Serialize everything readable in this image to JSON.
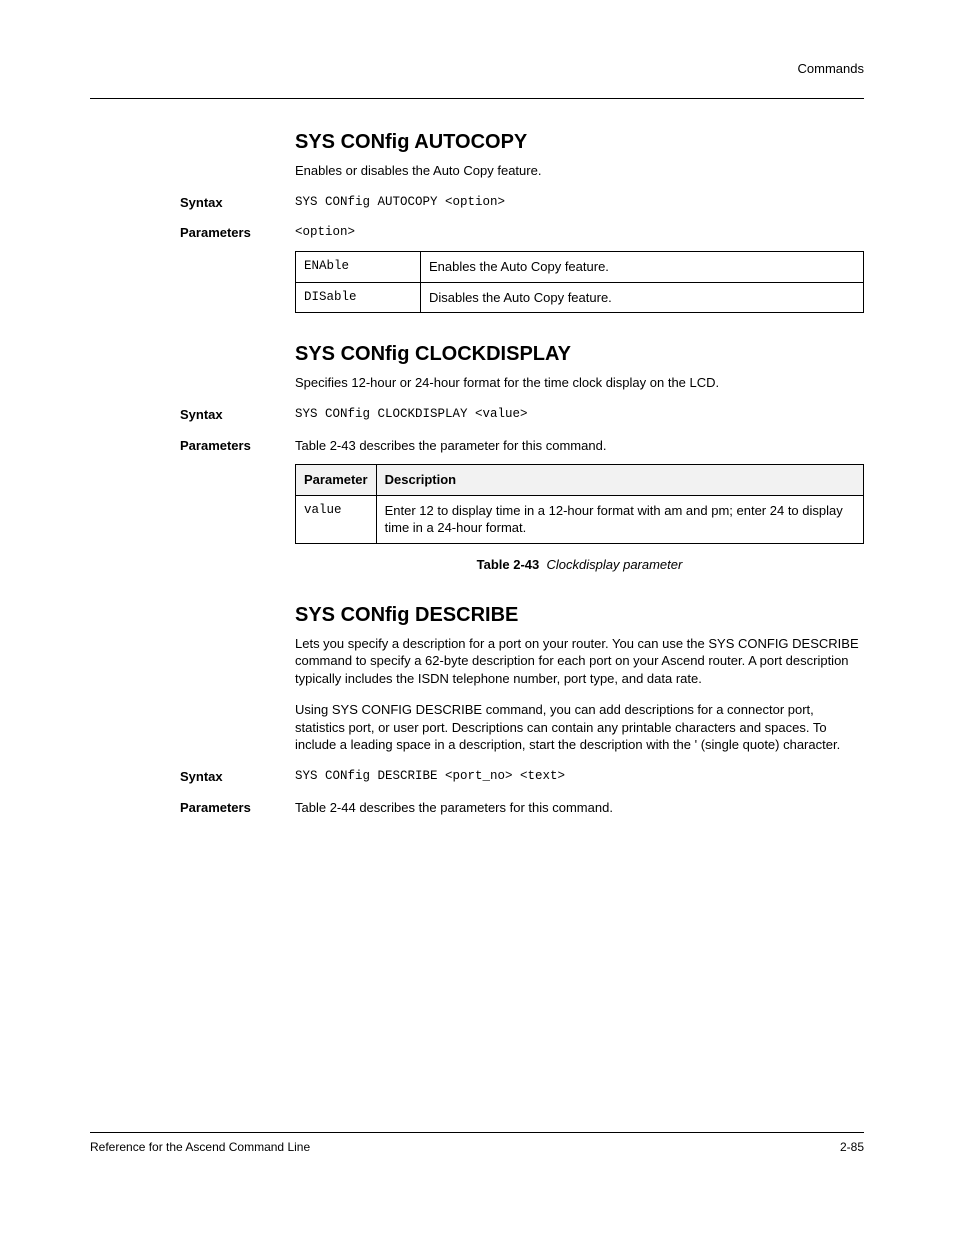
{
  "header": {
    "right": "Commands"
  },
  "section1": {
    "title": "SYS CONfig AUTOCOPY",
    "desc": "Enables or disables the Auto Copy feature.",
    "labels": {
      "syntax": "Syntax",
      "parameters": "Parameters"
    },
    "syntax": "SYS CONfig AUTOCOPY <option>",
    "parameters_intro": "<option>",
    "params": [
      {
        "key": "ENAble",
        "val": "Enables the Auto Copy feature."
      },
      {
        "key": "DISable",
        "val": "Disables the Auto Copy feature."
      }
    ]
  },
  "section2": {
    "title": "SYS CONfig CLOCKDISPLAY",
    "desc": "Specifies 12-hour or 24-hour format for the time clock display on the LCD.",
    "labels": {
      "syntax": "Syntax",
      "parameters": "Parameters"
    },
    "syntax": "SYS CONfig CLOCKDISPLAY <value>",
    "parameters_intro": "Table 2-43 describes the parameter for this command.",
    "table_headers": {
      "param": "Parameter",
      "desc": "Description"
    },
    "params": [
      {
        "key": "value",
        "val": "Enter 12 to display time in a 12-hour format with am and pm; enter 24 to display time in a 24-hour format."
      }
    ],
    "caption_num": "Table 2-43",
    "caption_text": "Clockdisplay parameter"
  },
  "section3": {
    "title": "SYS CONfig DESCRIBE",
    "desc": "Lets you specify a description for a port on your router. You can use the SYS CONFIG DESCRIBE command to specify a 62-byte description for each port on your Ascend router. A port description typically includes the ISDN telephone number, port type, and data rate.",
    "desc2": "Using SYS CONFIG DESCRIBE command, you can add descriptions for a connector port, statistics port, or user port. Descriptions can contain any printable characters and spaces. To include a leading space in a description, start the description with the ' (single quote) character.",
    "labels": {
      "syntax": "Syntax",
      "parameters": "Parameters"
    },
    "syntax": "SYS CONfig DESCRIBE <port_no> <text>",
    "parameters_intro": "Table 2-44 describes the parameters for this command."
  },
  "footer": {
    "left": "Reference for the Ascend Command Line",
    "right": "2-85"
  }
}
